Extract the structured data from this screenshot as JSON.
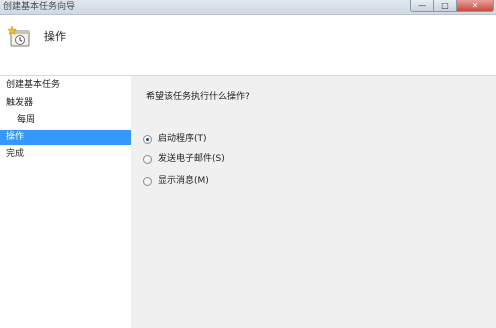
{
  "window": {
    "title": "创建基本任务向导",
    "controls": {
      "minimize": "—",
      "maximize": "□",
      "close": "✕"
    }
  },
  "header": {
    "icon": "task-wizard-icon",
    "heading": "操作"
  },
  "sidebar": {
    "items": [
      {
        "label": "创建基本任务",
        "selected": false
      },
      {
        "label": "触发器",
        "selected": false
      },
      {
        "label": "每周",
        "selected": false
      },
      {
        "label": "操作",
        "selected": true
      },
      {
        "label": "完成",
        "selected": false
      }
    ]
  },
  "main": {
    "question": "希望该任务执行什么操作?",
    "options": [
      {
        "label": "启动程序(T)",
        "checked": true
      },
      {
        "label": "发送电子邮件(S)",
        "checked": false
      },
      {
        "label": "显示消息(M)",
        "checked": false
      }
    ]
  },
  "colors": {
    "selection": "#3399ff",
    "panel": "#f0f0f0",
    "header": "#ffffff"
  }
}
